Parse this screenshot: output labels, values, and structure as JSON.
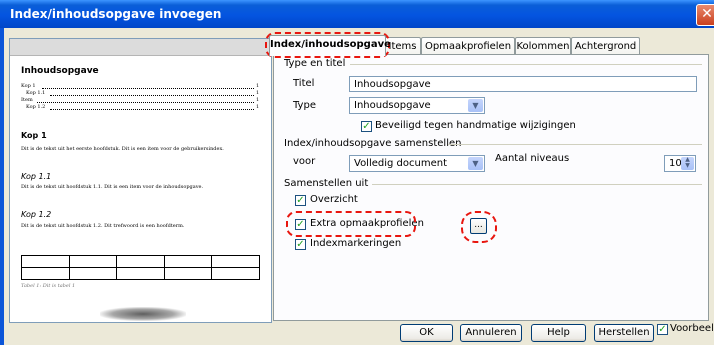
{
  "window": {
    "title": "Index/inhoudsopgave invoegen",
    "close_glyph": "✕"
  },
  "preview": {
    "title": "Inhoudsopgave",
    "toc": [
      {
        "text": "Kop 1",
        "page": "1"
      },
      {
        "text": "Kop 1.1",
        "page": "1"
      },
      {
        "text": "Item",
        "page": "1"
      },
      {
        "text": "Kop 1.2",
        "page": "1"
      }
    ],
    "kop1": "Kop 1",
    "kop1_text": "Dit is de tekst uit het eerste hoofdstuk. Dit is een item voor de gebruikersindex.",
    "kop11": "Kop 1.1",
    "kop11_text": "Dit is de tekst uit hoofdstuk 1.1. Dit is een item voor de inhoudsopgave.",
    "kop12": "Kop 1.2",
    "kop12_text": "Dit is de tekst uit hoofdstuk 1.2. Dit trefwoord is een hoofdterm.",
    "caption": "Tabel 1: Dit is tabel 1"
  },
  "tabs": [
    "Index/inhoudsopgave",
    "Items",
    "Opmaakprofielen",
    "Kolommen",
    "Achtergrond"
  ],
  "type_section": {
    "heading": "Type en titel",
    "title_label": "Titel",
    "title_value": "Inhoudsopgave",
    "type_label": "Type",
    "type_value": "Inhoudsopgave",
    "protect_label": "Beveiligd tegen handmatige wijzigingen"
  },
  "create_section": {
    "heading": "Index/inhoudsopgave samenstellen",
    "for_label": "voor",
    "for_value": "Volledig document",
    "levels_label": "Aantal niveaus",
    "levels_value": "10"
  },
  "from_section": {
    "heading": "Samenstellen uit",
    "outline_label": "Overzicht",
    "extra_label": "Extra opmaakprofielen",
    "markers_label": "Indexmarkeringen",
    "dots": "..."
  },
  "buttons": {
    "ok": "OK",
    "cancel": "Annuleren",
    "help": "Help",
    "reset": "Herstellen",
    "preview": "Voorbeeld"
  },
  "colors": {
    "titlebar": "#0454e0",
    "highlight": "#e8160f",
    "dialog_bg": "#ece9d8"
  }
}
